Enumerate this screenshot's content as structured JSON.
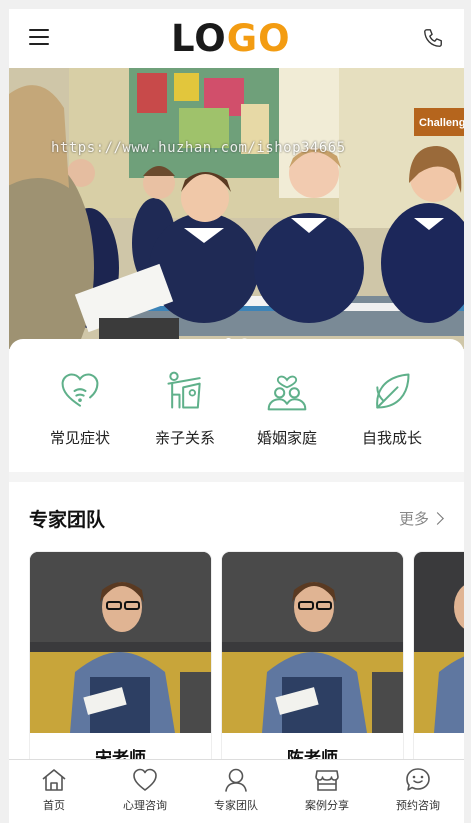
{
  "header": {
    "logo_part1": "LO",
    "logo_part2": "GO"
  },
  "banner": {
    "watermark": "https://www.huzhan.com/ishop34665",
    "wall_sign": "Challeng",
    "slide_count": 2,
    "active_slide": 0
  },
  "categories": [
    {
      "label": "常见症状",
      "icon": "heart-signal-icon"
    },
    {
      "label": "亲子关系",
      "icon": "parent-child-icon"
    },
    {
      "label": "婚姻家庭",
      "icon": "couple-heart-icon"
    },
    {
      "label": "自我成长",
      "icon": "leaf-icon"
    }
  ],
  "expert": {
    "title": "专家团队",
    "more_label": "更多",
    "cards": [
      {
        "name": "宋老师"
      },
      {
        "name": "陈老师"
      }
    ]
  },
  "bottom_nav": [
    {
      "label": "首页",
      "icon": "home-icon"
    },
    {
      "label": "心理咨询",
      "icon": "heart-icon"
    },
    {
      "label": "专家团队",
      "icon": "user-icon"
    },
    {
      "label": "案例分享",
      "icon": "store-icon"
    },
    {
      "label": "预约咨询",
      "icon": "chat-icon"
    }
  ],
  "colors": {
    "accent_green": "#5fb08a",
    "logo_orange": "#f39c12",
    "logo_dark": "#1a1a1a"
  }
}
